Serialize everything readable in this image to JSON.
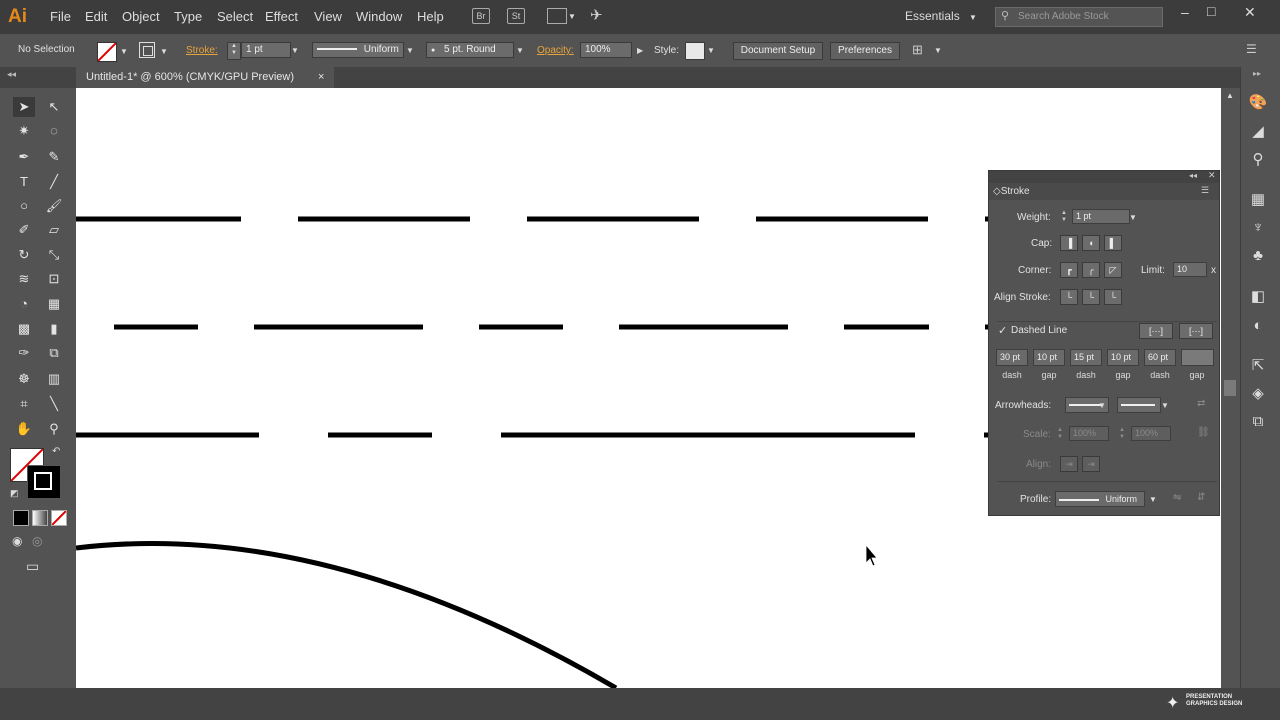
{
  "app": {
    "logo": "Ai"
  },
  "menu": [
    "File",
    "Edit",
    "Object",
    "Type",
    "Select",
    "Effect",
    "View",
    "Window",
    "Help"
  ],
  "menubar_icons": {
    "bridge": "Br",
    "stock": "St"
  },
  "workspace": "Essentials",
  "search": {
    "placeholder": "Search Adobe Stock"
  },
  "control_bar": {
    "selection": "No Selection",
    "stroke_label": "Stroke:",
    "stroke_weight": "1 pt",
    "profile": "Uniform",
    "brush": "5 pt. Round",
    "opacity_label": "Opacity:",
    "opacity_value": "100%",
    "style_label": "Style:",
    "document_setup": "Document Setup",
    "preferences": "Preferences"
  },
  "document_tab": {
    "title": "Untitled-1* @ 600% (CMYK/GPU Preview)",
    "close": "×"
  },
  "stroke_panel": {
    "title": "Stroke",
    "weight_label": "Weight:",
    "weight_value": "1 pt",
    "cap_label": "Cap:",
    "corner_label": "Corner:",
    "limit_label": "Limit:",
    "limit_value": "10",
    "limit_unit": "x",
    "align_label": "Align Stroke:",
    "dashed_label": "Dashed Line",
    "dash_values": [
      "30 pt",
      "10 pt",
      "15 pt",
      "10 pt",
      "60 pt",
      ""
    ],
    "dash_labels": [
      "dash",
      "gap",
      "dash",
      "gap",
      "dash",
      "gap"
    ],
    "arrowheads_label": "Arrowheads:",
    "scale_label": "Scale:",
    "scale_start": "100%",
    "scale_end": "100%",
    "align_arrow_label": "Align:",
    "profile_label": "Profile:",
    "profile_value": "Uniform"
  },
  "watermark": {
    "line1": "PRESENTATION",
    "line2": "GRAPHICS DESIGN"
  },
  "colors": {
    "accent": "#e8891a",
    "panel": "#535353",
    "dark": "#3c3c3c",
    "canvas": "#ffffff"
  }
}
